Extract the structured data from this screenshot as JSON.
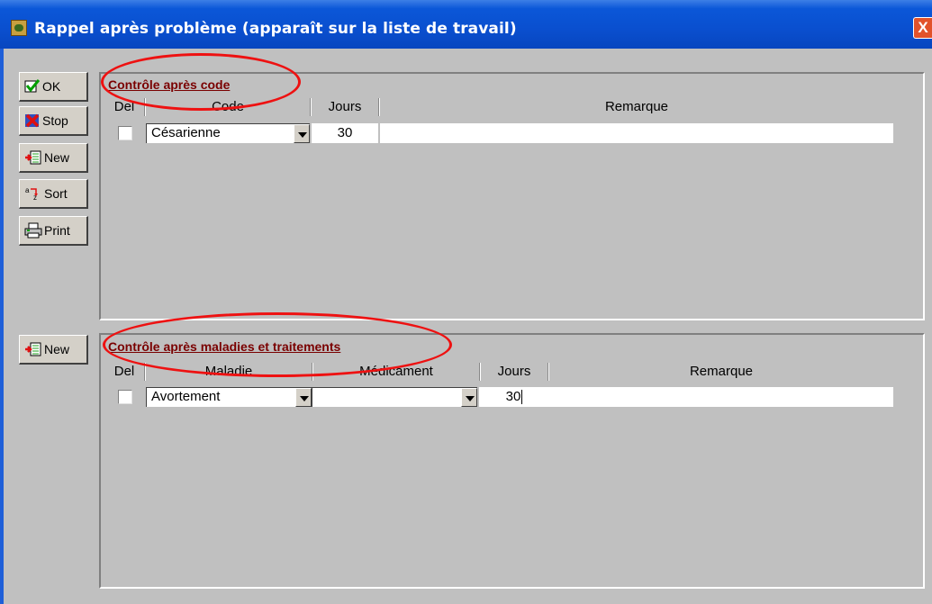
{
  "window": {
    "title": "Rappel après problème (apparaît sur la liste de travail)",
    "close_label": "X"
  },
  "toolbar": {
    "ok_label": "OK",
    "stop_label": "Stop",
    "new_label": "New",
    "sort_label": "Sort",
    "print_label": "Print",
    "new2_label": "New"
  },
  "code_panel": {
    "title": "Contrôle après code",
    "columns": [
      "Del",
      "Code",
      "Jours",
      "Remarque"
    ],
    "rows": [
      {
        "del": false,
        "code": "Césarienne",
        "jours": "30",
        "remarque": ""
      }
    ]
  },
  "maladie_panel": {
    "title": "Contrôle après maladies et traitements",
    "columns": [
      "Del",
      "Maladie",
      "Médicament",
      "Jours",
      "Remarque"
    ],
    "rows": [
      {
        "del": false,
        "maladie": "Avortement",
        "medicament": "",
        "jours": "30",
        "remarque": ""
      }
    ]
  },
  "colors": {
    "title_bar": "#0a4fcf",
    "client_bg": "#c0c0c0",
    "annotation": "#ee1111",
    "panel_title": "#7a0000"
  }
}
